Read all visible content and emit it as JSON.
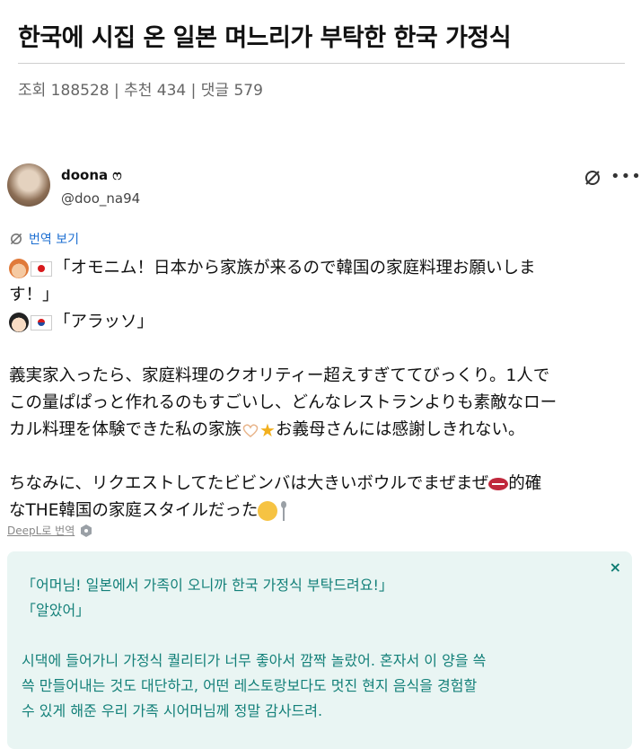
{
  "article": {
    "title": "한국에 시집 온 일본 며느리가 부탁한 한국 가정식",
    "meta": "조회 188528 | 추천 434 | 댓글 579"
  },
  "post": {
    "author_name": "doona ෆ",
    "author_handle": "@doo_na94",
    "translate_link": "번역 보기",
    "line1": "「オモニム！日本から家族が来るので韓国の家庭料理お願いしま",
    "line2": "す！」",
    "line3": "「アラッソ」",
    "para2_l1": "義実家入ったら、家庭料理のクオリティー超えすぎててびっくり。1人で",
    "para2_l2": "この量ぱぱっと作れるのもすごいし、どんなレストランよりも素敵なロー",
    "para2_l3a": "カル料理を体験できた私の家族",
    "para2_l3b": "お義母さんには感謝しきれない。",
    "para3_l1a": "ちなみに、リクエストしてたビビンバは大きいボウルでまぜまぜ",
    "para3_l1b": "的確",
    "para3_l2": "なTHE韓国の家庭スタイルだった",
    "deepl": "DeepL로 번역"
  },
  "translation": {
    "close": "×",
    "l1": "「어머님! 일본에서 가족이 오니까 한국 가정식 부탁드려요!」",
    "l2": "「알았어」",
    "l3": "시댁에 들어가니 가정식 퀄리티가 너무 좋아서 깜짝 놀랐어. 혼자서 이 양을 쓱",
    "l4": "쓱 만들어내는 것도 대단하고, 어떤 레스토랑보다도 멋진 현지 음식을 경험할",
    "l5": "수 있게 해준 우리 가족 시어머님께 정말 감사드려."
  },
  "icons": {
    "no_translate": "translate-off-icon",
    "more": "more-icon",
    "deepl": "deepl-icon"
  },
  "colors": {
    "link": "#1d6fd2",
    "translation_bg": "#e9f5f3",
    "translation_text": "#138079"
  }
}
